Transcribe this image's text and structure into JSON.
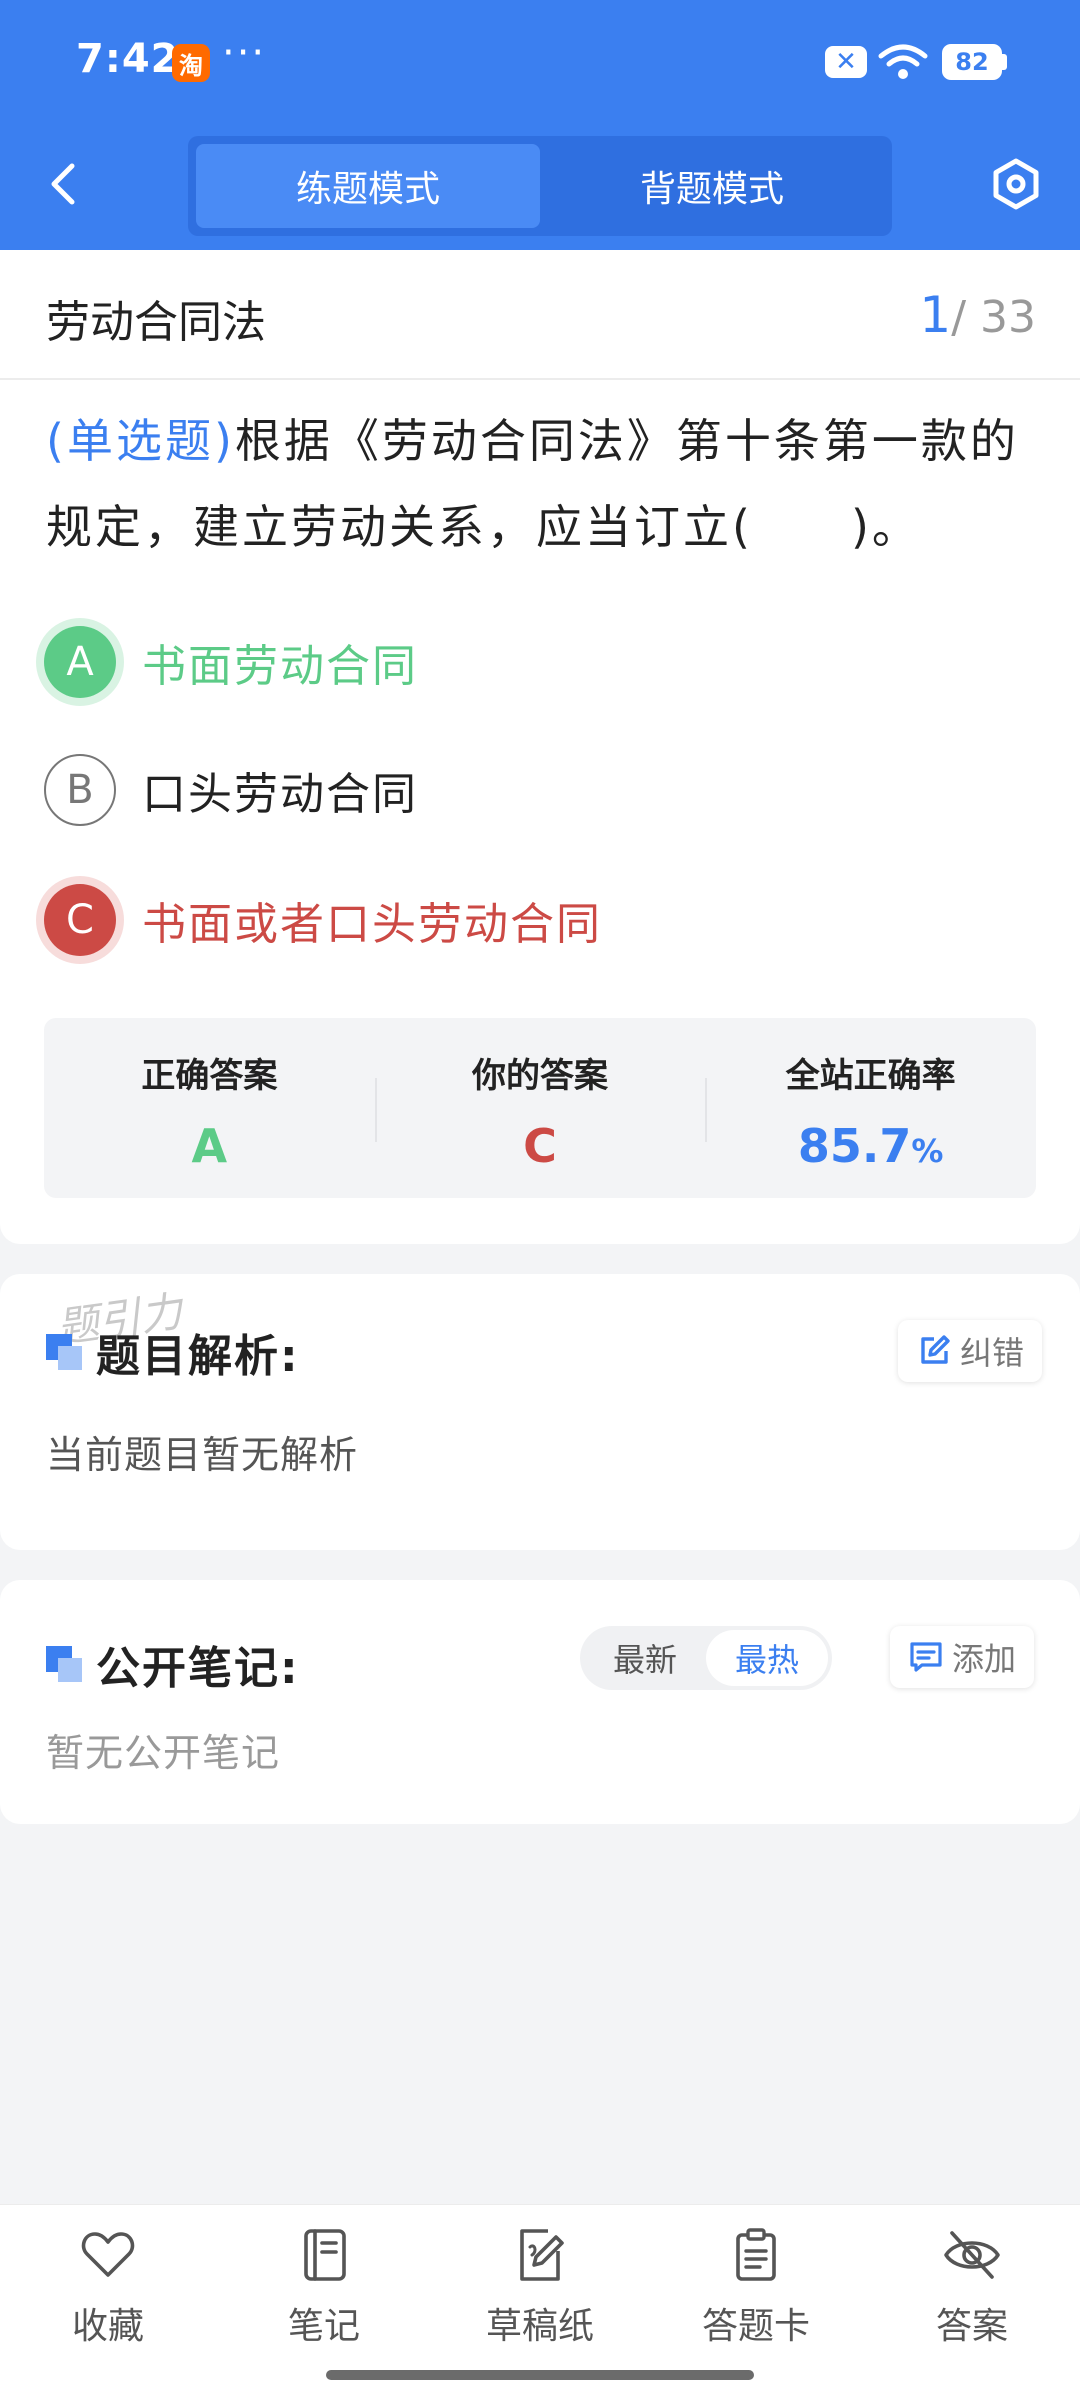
{
  "status_bar": {
    "time": "7:42",
    "app_icon_label": "淘",
    "more": "···",
    "battery": "82"
  },
  "header": {
    "tabs": [
      {
        "label": "练题模式",
        "active": true
      },
      {
        "label": "背题模式",
        "active": false
      }
    ],
    "icons": {
      "back": "chevron-left-icon",
      "settings": "hexagon-settings-icon"
    }
  },
  "question": {
    "category": "劳动合同法",
    "current": "1",
    "total": "/ 33",
    "type": "(单选题)",
    "stem": "根据《劳动合同法》第十条第一款的规定，建立劳动关系，应当订立(　　)。",
    "options": [
      {
        "letter": "A",
        "text": "书面劳动合同",
        "state": "correct"
      },
      {
        "letter": "B",
        "text": "口头劳动合同",
        "state": "normal"
      },
      {
        "letter": "C",
        "text": "书面或者口头劳动合同",
        "state": "wrong"
      }
    ]
  },
  "stats": {
    "correct_label": "正确答案",
    "correct_value": "A",
    "your_label": "你的答案",
    "your_value": "C",
    "rate_label": "全站正确率",
    "rate_value": "85.7",
    "rate_unit": "%"
  },
  "analysis": {
    "watermark": "题引力",
    "title": "题目解析:",
    "report_label": "纠错",
    "body": "当前题目暂无解析"
  },
  "notes": {
    "title": "公开笔记:",
    "sort_options": [
      "最新",
      "最热"
    ],
    "sort_active": "最热",
    "add_label": "添加",
    "body": "暂无公开笔记"
  },
  "bottom_bar": {
    "items": [
      {
        "label": "收藏",
        "icon": "heart-icon"
      },
      {
        "label": "笔记",
        "icon": "notebook-icon"
      },
      {
        "label": "草稿纸",
        "icon": "draft-paper-icon"
      },
      {
        "label": "答题卡",
        "icon": "answer-sheet-icon"
      },
      {
        "label": "答案",
        "icon": "eye-off-icon"
      }
    ]
  },
  "colors": {
    "primary": "#3b7ff0",
    "correct": "#5ccb87",
    "wrong": "#cc4a45",
    "background": "#f3f4f6"
  }
}
